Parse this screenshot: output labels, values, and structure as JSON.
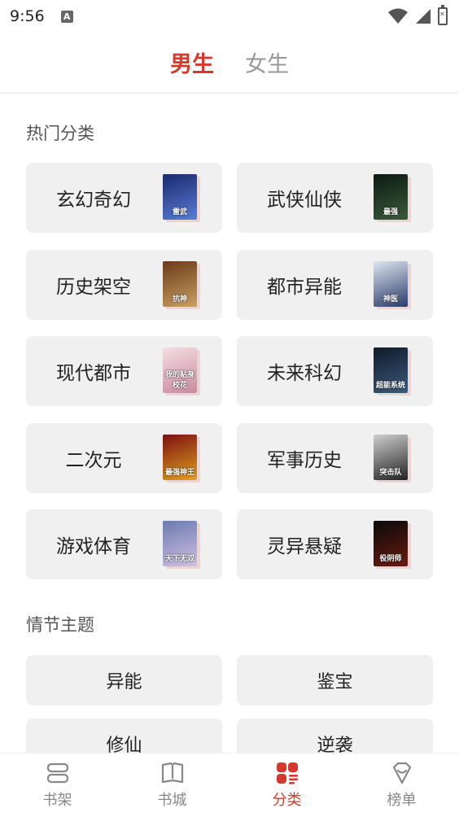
{
  "status_bar": {
    "time": "9:56",
    "notification_letter": "A"
  },
  "gender_tabs": [
    {
      "label": "男生",
      "active": true
    },
    {
      "label": "女生",
      "active": false
    }
  ],
  "hot_categories": {
    "title": "热门分类",
    "items": [
      {
        "label": "玄幻奇幻",
        "cover_text": "雷武",
        "cover_colors": [
          "#1a2a6c",
          "#5a7bd8"
        ]
      },
      {
        "label": "武侠仙侠",
        "cover_text": "最强",
        "cover_colors": [
          "#0d1a12",
          "#3a5a3a"
        ]
      },
      {
        "label": "历史架空",
        "cover_text": "抗神",
        "cover_colors": [
          "#6b3a1a",
          "#c9a060"
        ]
      },
      {
        "label": "都市异能",
        "cover_text": "神医",
        "cover_colors": [
          "#dfe6f0",
          "#2a3a6a"
        ]
      },
      {
        "label": "现代都市",
        "cover_text": "我的贴身校花",
        "cover_colors": [
          "#f5dde3",
          "#c98aa0"
        ]
      },
      {
        "label": "未来科幻",
        "cover_text": "超能系统",
        "cover_colors": [
          "#111a2a",
          "#3a5a7a"
        ]
      },
      {
        "label": "二次元",
        "cover_text": "最强神王",
        "cover_colors": [
          "#7a1010",
          "#e0a020"
        ]
      },
      {
        "label": "军事历史",
        "cover_text": "突击队",
        "cover_colors": [
          "#cfcfcf",
          "#222222"
        ]
      },
      {
        "label": "游戏体育",
        "cover_text": "天下无双",
        "cover_colors": [
          "#6a7ab0",
          "#d0c0e0"
        ]
      },
      {
        "label": "灵异悬疑",
        "cover_text": "役阴师",
        "cover_colors": [
          "#0a0a0a",
          "#6a1a10"
        ]
      }
    ]
  },
  "plot_themes": {
    "title": "情节主题",
    "items": [
      "异能",
      "鉴宝",
      "修仙",
      "逆袭"
    ]
  },
  "bottom_nav": [
    {
      "label": "书架",
      "icon": "bookshelf-icon",
      "active": false
    },
    {
      "label": "书城",
      "icon": "bookstore-icon",
      "active": false
    },
    {
      "label": "分类",
      "icon": "category-icon",
      "active": true
    },
    {
      "label": "榜单",
      "icon": "ranking-icon",
      "active": false
    }
  ],
  "colors": {
    "accent": "#d7382e",
    "card_bg": "#f0f0f0",
    "inactive": "#999999"
  }
}
